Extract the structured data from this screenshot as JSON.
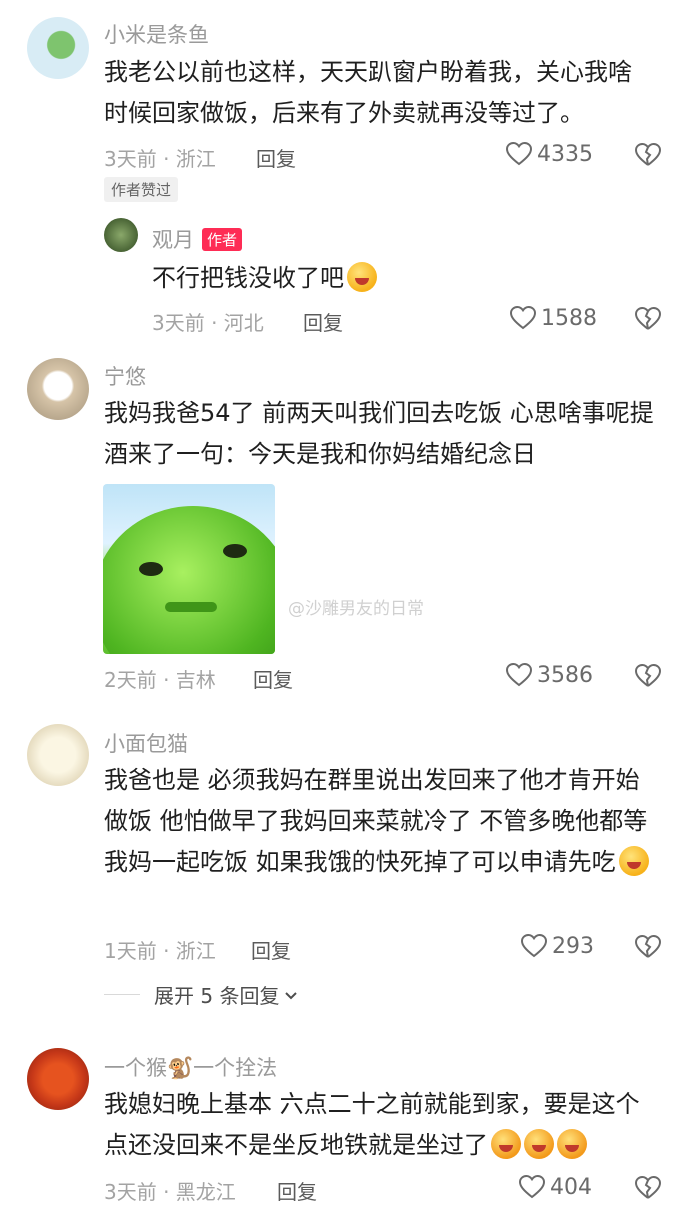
{
  "comments": [
    {
      "username": "小米是条鱼",
      "text": "我老公以前也这样，天天趴窗户盼着我，关心我啥时候回家做饭，后来有了外卖就再没等过了。",
      "meta": "3天前 · 浙江",
      "reply_label": "回复",
      "likes": "4335",
      "author_liked_badge": "作者赞过"
    },
    {
      "username": "观月",
      "author_badge": "作者",
      "text": "不行把钱没收了吧",
      "meta": "3天前 · 河北",
      "reply_label": "回复",
      "likes": "1588"
    },
    {
      "username": "宁悠",
      "text": "我妈我爸54了 前两天叫我们回去吃饭 心思啥事呢提酒来了一句：今天是我和你妈结婚纪念日",
      "meta": "2天前 · 吉林",
      "reply_label": "回复",
      "likes": "3586",
      "watermark": "@沙雕男友的日常"
    },
    {
      "username": "小面包猫",
      "text": "我爸也是 必须我妈在群里说出发回来了他才肯开始做饭 他怕做早了我妈回来菜就冷了 不管多晚他都等我妈一起吃饭 如果我饿的快死掉了可以申请先吃",
      "meta": "1天前 · 浙江",
      "reply_label": "回复",
      "likes": "293",
      "expand_label": "展开 5 条回复"
    },
    {
      "username": "一个猴🐒一个拴法",
      "text": "我媳妇晚上基本 六点二十之前就能到家，要是这个点还没回来不是坐反地铁就是坐过了",
      "meta": "3天前 · 黑龙江",
      "reply_label": "回复",
      "likes": "404"
    }
  ],
  "icons": {
    "like": "heart-outline-icon",
    "dislike": "broken-heart-icon",
    "expand": "chevron-down-icon"
  }
}
